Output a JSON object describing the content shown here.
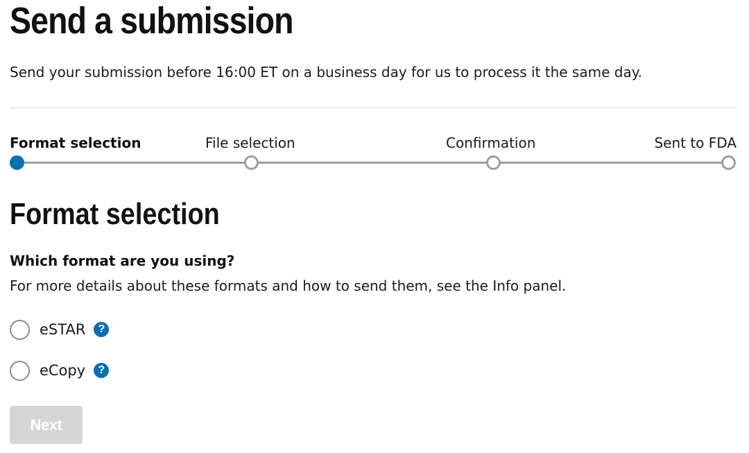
{
  "page": {
    "title": "Send a submission",
    "intro": "Send your submission before 16:00 ET on a business day for us to process it the same day."
  },
  "stepper": {
    "steps": [
      {
        "label": "Format selection",
        "state": "current"
      },
      {
        "label": "File selection",
        "state": "upcoming"
      },
      {
        "label": "Confirmation",
        "state": "upcoming"
      },
      {
        "label": "Sent to FDA",
        "state": "upcoming"
      }
    ]
  },
  "section": {
    "title": "Format selection",
    "question": "Which format are you using?",
    "hint": "For more details about these formats and how to send them, see the Info panel."
  },
  "options": [
    {
      "label": "eSTAR",
      "selected": false,
      "help_icon": "question-circle-icon"
    },
    {
      "label": "eCopy",
      "selected": false,
      "help_icon": "question-circle-icon"
    }
  ],
  "actions": {
    "next_label": "Next",
    "next_disabled": true
  },
  "colors": {
    "accent": "#0a6fb3",
    "step_line": "#9e9e9e",
    "disabled_button": "#d6d6d6"
  },
  "icons": {
    "help_glyph": "?"
  }
}
